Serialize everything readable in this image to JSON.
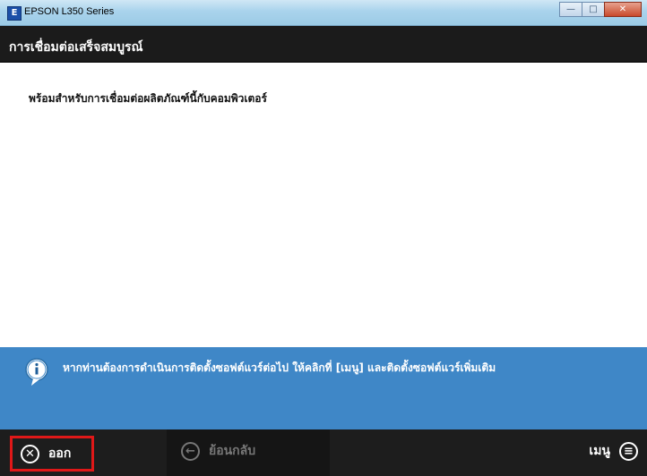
{
  "window": {
    "title": "EPSON L350 Series",
    "icon_letter": "E",
    "minimize_glyph": "—",
    "maximize_glyph": "□",
    "close_glyph": "✕"
  },
  "header": {
    "title": "การเชื่อมต่อเสร็จสมบูรณ์"
  },
  "main": {
    "message": "พร้อมสำหรับการเชื่อมต่อผลิตภัณฑ์นี้กับคอมพิวเตอร์"
  },
  "info": {
    "icon": "info-speech-bubble-icon",
    "text": "หากท่านต้องการดำเนินการติดตั้งซอฟต์แวร์ต่อไป ให้คลิกที่ [เมนู] และติดตั้งซอฟต์แวร์เพิ่มเติม"
  },
  "footer": {
    "exit": {
      "label": "ออก",
      "icon": "close-circle-icon",
      "glyph": "✕"
    },
    "back": {
      "label": "ย้อนกลับ",
      "icon": "back-arrow-circle-icon",
      "glyph": "←",
      "enabled": false
    },
    "menu": {
      "label": "เมนู",
      "icon": "menu-circle-icon",
      "glyph": "≡"
    }
  },
  "colors": {
    "header_bg": "#1b1b1b",
    "info_bg": "#3f87c7",
    "footer_bg": "#1d1d1d",
    "exit_highlight": "#e01818",
    "disabled_text": "#777777"
  }
}
